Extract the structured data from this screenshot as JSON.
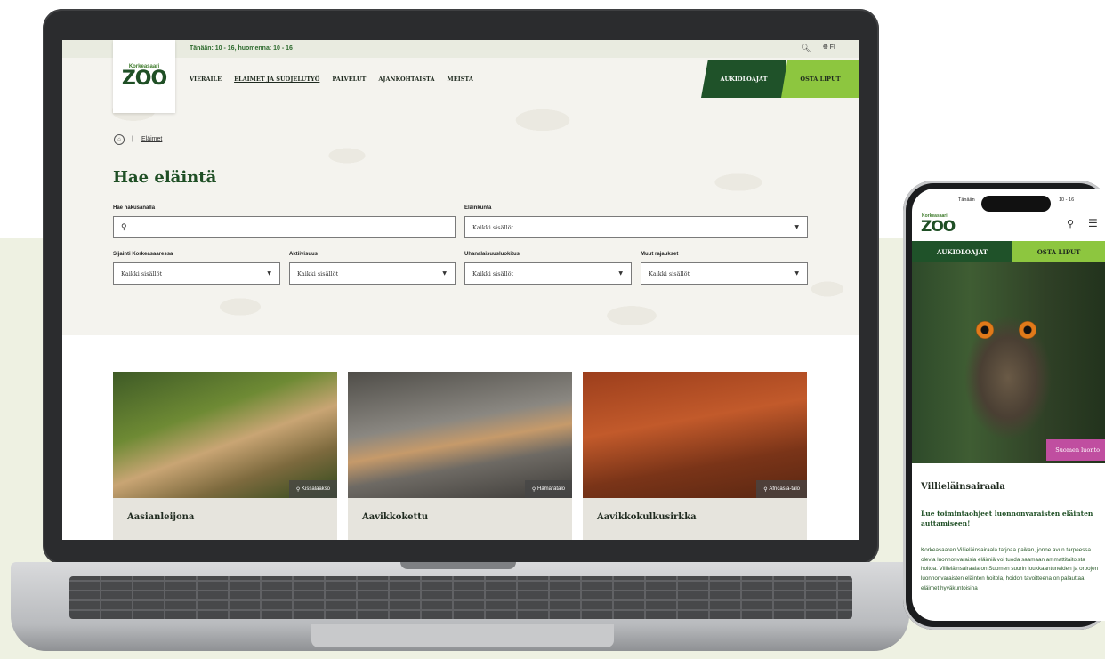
{
  "colors": {
    "brand_dark_green": "#1f5229",
    "brand_lime": "#8dc63f",
    "tag_magenta": "#c04ea0",
    "backdrop": "#eef1e2"
  },
  "desktop": {
    "topbar": {
      "hours": "Tänään: 10 - 16, huomenna: 10 - 16",
      "search_icon": "search-icon",
      "language": "FI",
      "language_icon": "globe-icon"
    },
    "logo": {
      "small": "Korkeasaari",
      "main": "ZOO"
    },
    "nav": [
      "VIERAILE",
      "ELÄIMET JA SUOJELUTYÖ",
      "PALVELUT",
      "AJANKOHTAISTA",
      "MEISTÄ"
    ],
    "nav_active_index": 1,
    "cta": {
      "primary": "AUKIOLOAJAT",
      "secondary": "OSTA LIPUT"
    },
    "breadcrumb": {
      "home_icon": "home-icon",
      "separator": "|",
      "current": "Eläimet"
    },
    "title": "Hae eläintä",
    "filters": {
      "search": {
        "label": "Hae hakusanalla",
        "value": ""
      },
      "kingdom": {
        "label": "Eläinkunta",
        "value": "Kaikki sisällöt"
      },
      "location": {
        "label": "Sijainti Korkeasaaressa",
        "value": "Kaikki sisällöt"
      },
      "activity": {
        "label": "Aktiivisuus",
        "value": "Kaikki sisällöt"
      },
      "threat": {
        "label": "Uhanalaisuusluokitus",
        "value": "Kaikki sisällöt"
      },
      "other": {
        "label": "Muut rajaukset",
        "value": "Kaikki sisällöt"
      }
    },
    "animals": [
      {
        "name": "Aasianleijona",
        "location": "Kissalaakso"
      },
      {
        "name": "Aavikkokettu",
        "location": "Hämärätalo"
      },
      {
        "name": "Aavikkokulkusirkka",
        "location": "Africasia-talo"
      }
    ]
  },
  "mobile": {
    "status_left": "Tänään",
    "status_right": "10 - 16",
    "logo": {
      "small": "Korkeasaari",
      "main": "ZOO"
    },
    "cta": {
      "primary": "AUKIOLOAJAT",
      "secondary": "OSTA LIPUT"
    },
    "hero_tag": "Suomen luonto",
    "heading": "Villieläinsairaala",
    "subheading": "Lue toimintaohjeet luonnonvaraisten eläinten auttamiseen!",
    "body": "Korkeasaaren Villieläinsairaala tarjoaa paikan, jonne avun tarpeessa olevia luonnonvaraisia eläimiä voi tuoda saamaan ammattitaitoista hoitoa. Villieläinsairaala on Suomen suurin loukkaantuneiden ja orpojen luonnonvaraisten eläinten hoitola, hoidon tavoitteena on palauttaa eläimet hyväkuntoisina"
  }
}
